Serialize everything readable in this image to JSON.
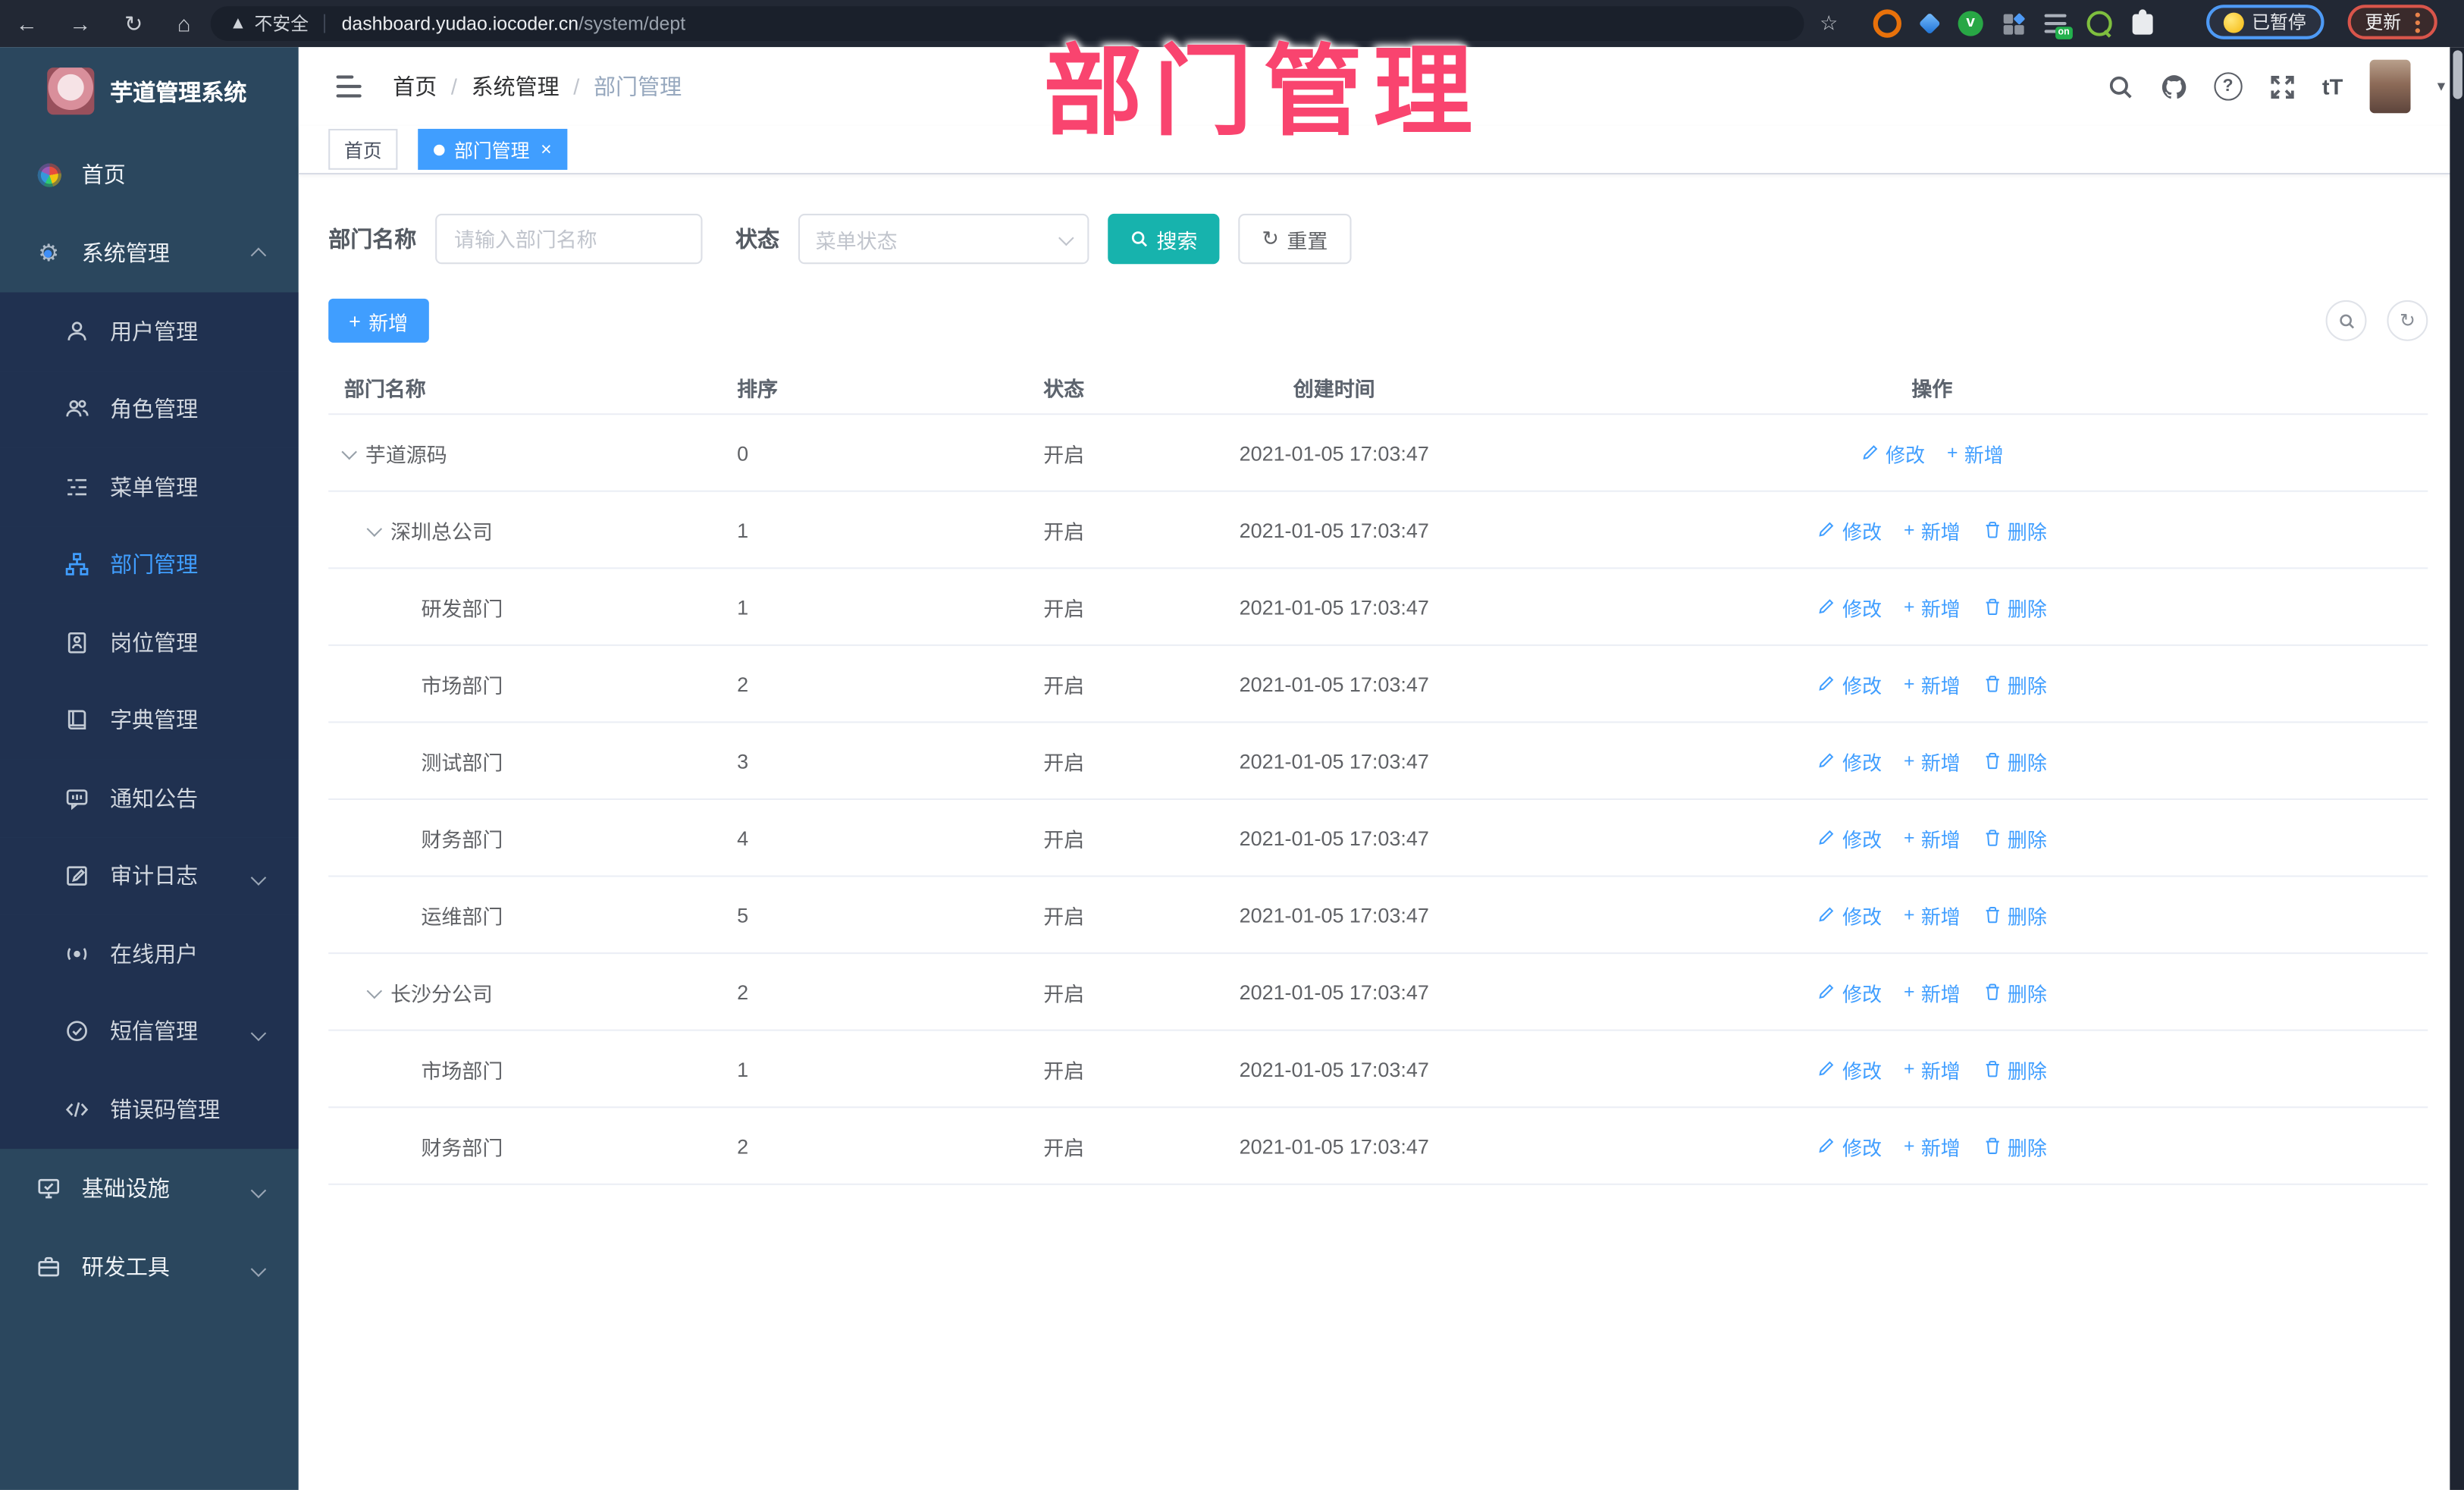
{
  "browser": {
    "security_label": "不安全",
    "url_domain": "dashboard.yudao.iocoder.cn",
    "url_path": "/system/dept",
    "paused_badge": "已暂停",
    "update_badge": "更新"
  },
  "overlay": {
    "annotation": "部门管理"
  },
  "sidebar": {
    "logo_title": "芋道管理系统",
    "items": [
      {
        "label": "首页",
        "icon": "dashboard-icon",
        "type": "root"
      },
      {
        "label": "系统管理",
        "icon": "gear-icon",
        "type": "root",
        "chevron": "up",
        "expanded": true
      },
      {
        "label": "用户管理",
        "icon": "user-icon",
        "type": "sub"
      },
      {
        "label": "角色管理",
        "icon": "users-icon",
        "type": "sub"
      },
      {
        "label": "菜单管理",
        "icon": "menu-tree-icon",
        "type": "sub"
      },
      {
        "label": "部门管理",
        "icon": "org-tree-icon",
        "type": "sub",
        "active": true
      },
      {
        "label": "岗位管理",
        "icon": "badge-icon",
        "type": "sub"
      },
      {
        "label": "字典管理",
        "icon": "book-icon",
        "type": "sub"
      },
      {
        "label": "通知公告",
        "icon": "announcement-icon",
        "type": "sub"
      },
      {
        "label": "审计日志",
        "icon": "log-icon",
        "type": "sub",
        "chevron": "down"
      },
      {
        "label": "在线用户",
        "icon": "online-user-icon",
        "type": "sub"
      },
      {
        "label": "短信管理",
        "icon": "sms-icon",
        "type": "sub",
        "chevron": "down"
      },
      {
        "label": "错误码管理",
        "icon": "code-icon",
        "type": "sub"
      },
      {
        "label": "基础设施",
        "icon": "infra-icon",
        "type": "root",
        "chevron": "down"
      },
      {
        "label": "研发工具",
        "icon": "tools-icon",
        "type": "root",
        "chevron": "down"
      }
    ]
  },
  "header": {
    "breadcrumb": [
      "首页",
      "系统管理",
      "部门管理"
    ],
    "breadcrumb_sep": "/",
    "font_size_glyph": "tT"
  },
  "tags": [
    {
      "label": "首页",
      "active": false
    },
    {
      "label": "部门管理",
      "active": true,
      "closable": true
    }
  ],
  "filters": {
    "name_label": "部门名称",
    "name_placeholder": "请输入部门名称",
    "name_value": "",
    "status_label": "状态",
    "status_placeholder": "菜单状态",
    "search_label": "搜索",
    "reset_label": "重置"
  },
  "toolbar": {
    "add_label": "新增"
  },
  "table": {
    "columns": [
      "部门名称",
      "排序",
      "状态",
      "创建时间",
      "操作"
    ],
    "actions": {
      "edit": "修改",
      "add": "新增",
      "delete": "删除"
    },
    "rows": [
      {
        "name": "芋道源码",
        "level": 0,
        "expandable": true,
        "sort": "0",
        "status": "开启",
        "created": "2021-01-05 17:03:47",
        "actions": [
          "edit",
          "add"
        ]
      },
      {
        "name": "深圳总公司",
        "level": 1,
        "expandable": true,
        "sort": "1",
        "status": "开启",
        "created": "2021-01-05 17:03:47",
        "actions": [
          "edit",
          "add",
          "delete"
        ]
      },
      {
        "name": "研发部门",
        "level": 2,
        "expandable": false,
        "sort": "1",
        "status": "开启",
        "created": "2021-01-05 17:03:47",
        "actions": [
          "edit",
          "add",
          "delete"
        ]
      },
      {
        "name": "市场部门",
        "level": 2,
        "expandable": false,
        "sort": "2",
        "status": "开启",
        "created": "2021-01-05 17:03:47",
        "actions": [
          "edit",
          "add",
          "delete"
        ]
      },
      {
        "name": "测试部门",
        "level": 2,
        "expandable": false,
        "sort": "3",
        "status": "开启",
        "created": "2021-01-05 17:03:47",
        "actions": [
          "edit",
          "add",
          "delete"
        ]
      },
      {
        "name": "财务部门",
        "level": 2,
        "expandable": false,
        "sort": "4",
        "status": "开启",
        "created": "2021-01-05 17:03:47",
        "actions": [
          "edit",
          "add",
          "delete"
        ]
      },
      {
        "name": "运维部门",
        "level": 2,
        "expandable": false,
        "sort": "5",
        "status": "开启",
        "created": "2021-01-05 17:03:47",
        "actions": [
          "edit",
          "add",
          "delete"
        ]
      },
      {
        "name": "长沙分公司",
        "level": 1,
        "expandable": true,
        "sort": "2",
        "status": "开启",
        "created": "2021-01-05 17:03:47",
        "actions": [
          "edit",
          "add",
          "delete"
        ]
      },
      {
        "name": "市场部门",
        "level": 2,
        "expandable": false,
        "sort": "1",
        "status": "开启",
        "created": "2021-01-05 17:03:47",
        "actions": [
          "edit",
          "add",
          "delete"
        ]
      },
      {
        "name": "财务部门",
        "level": 2,
        "expandable": false,
        "sort": "2",
        "status": "开启",
        "created": "2021-01-05 17:03:47",
        "actions": [
          "edit",
          "add",
          "delete"
        ]
      }
    ]
  },
  "colors": {
    "accent_blue": "#409eff",
    "search_teal": "#17b3ad",
    "annotation_pink": "#f9446f",
    "sidebar_bg": "#2b475e",
    "submenu_bg": "#203150",
    "browser_bar_bg": "#222834"
  }
}
